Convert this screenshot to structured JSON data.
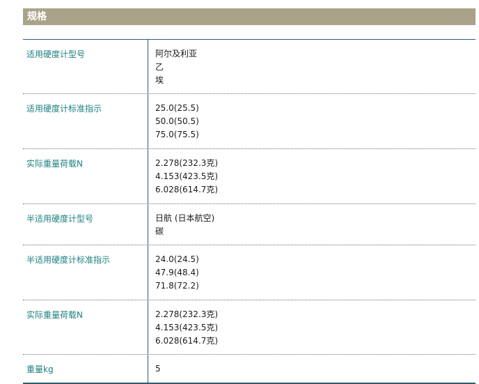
{
  "section": {
    "title": "规格"
  },
  "specs": [
    {
      "label": "适用硬度计型号",
      "values": [
        "阿尔及利亚",
        "乙",
        "埃"
      ]
    },
    {
      "label": "适用硬度计标准指示",
      "values": [
        "25.0(25.5)",
        "50.0(50.5)",
        "75.0(75.5)"
      ]
    },
    {
      "label": "实际重量荷载N",
      "values": [
        "2.278(232.3克)",
        "4.153(423.5克)",
        "6.028(614.7克)"
      ]
    },
    {
      "label": "半适用硬度计型号",
      "values": [
        "日航 (日本航空)",
        "碳"
      ]
    },
    {
      "label": "半适用硬度计标准指示",
      "values": [
        "24.0(24.5)",
        "47.9(48.4)",
        "71.8(72.2)"
      ]
    },
    {
      "label": "实际重量荷载N",
      "values": [
        "2.278(232.3克)",
        "4.153(423.5克)",
        "6.028(614.7克)"
      ]
    },
    {
      "label": "重量kg",
      "values": [
        "5"
      ]
    }
  ]
}
